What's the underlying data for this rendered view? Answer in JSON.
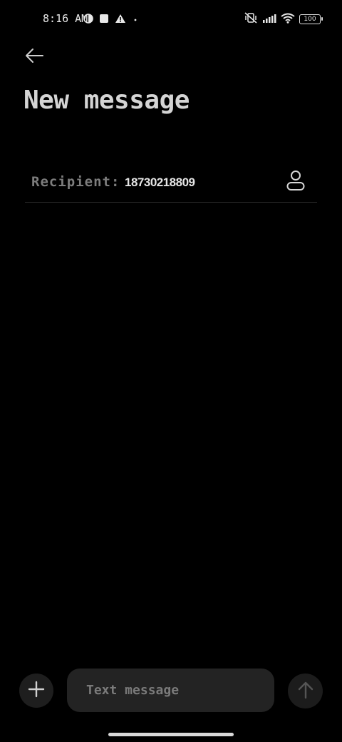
{
  "status_bar": {
    "time": "8:16 AM",
    "battery": "100",
    "icons": [
      "data-saver-icon",
      "square-notification-icon",
      "warning-icon",
      "dot-icon",
      "vibrate-off-icon",
      "signal-icon",
      "wifi-icon",
      "battery-icon"
    ]
  },
  "header": {
    "back_icon": "arrow-left-icon",
    "title": "New message"
  },
  "recipient": {
    "label": "Recipient:",
    "value": "18730218809",
    "contact_icon": "person-icon"
  },
  "composer": {
    "add_icon": "plus-icon",
    "placeholder": "Text message",
    "send_icon": "arrow-up-icon"
  },
  "colors": {
    "background": "#000000",
    "field": "#232323",
    "button": "#1e1e1e"
  }
}
